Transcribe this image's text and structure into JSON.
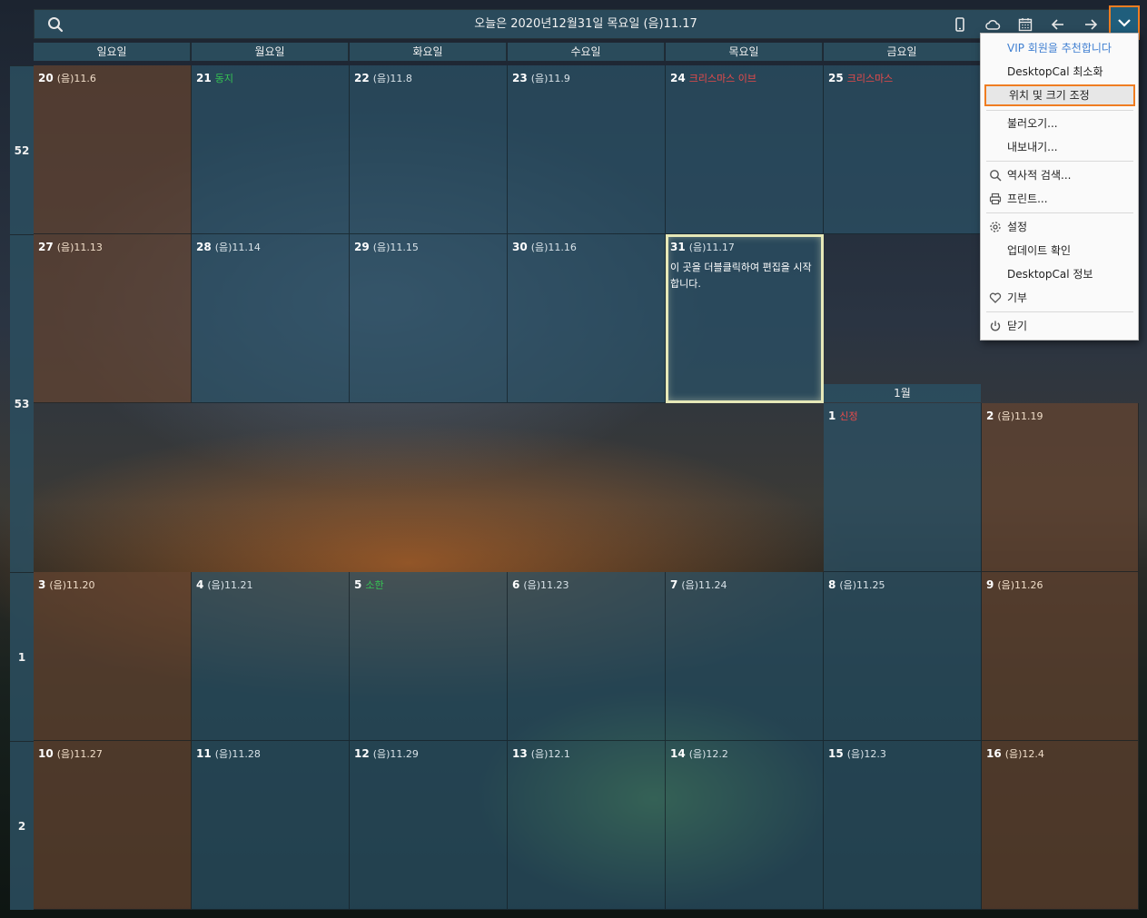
{
  "header": {
    "title": "오늘은 2020년12월31일 목요일 (음)11.17",
    "search_icon": "search-icon",
    "toolbar_icons": [
      "mobile-icon",
      "cloud-icon",
      "calendar-icon",
      "arrow-left-icon",
      "arrow-right-icon",
      "chevron-down-icon"
    ]
  },
  "days": [
    "일요일",
    "월요일",
    "화요일",
    "수요일",
    "목요일",
    "금요일"
  ],
  "month_label": "1월",
  "weeks": [
    "52",
    "53",
    "1",
    "2"
  ],
  "cells": {
    "c20": {
      "d": "20",
      "l": "(음)11.6"
    },
    "c21": {
      "d": "21",
      "h": "동지"
    },
    "c22": {
      "d": "22",
      "l": "(음)11.8"
    },
    "c23": {
      "d": "23",
      "l": "(음)11.9"
    },
    "c24": {
      "d": "24",
      "h": "크리스마스 이브"
    },
    "c25": {
      "d": "25",
      "h": "크리스마스"
    },
    "c27": {
      "d": "27",
      "l": "(음)11.13"
    },
    "c28": {
      "d": "28",
      "l": "(음)11.14"
    },
    "c29": {
      "d": "29",
      "l": "(음)11.15"
    },
    "c30": {
      "d": "30",
      "l": "(음)11.16"
    },
    "c31": {
      "d": "31",
      "l": "(음)11.17",
      "note": "이 곳을 더블클릭하여 편집을 시작합니다."
    },
    "j1": {
      "d": "1",
      "h": "신정"
    },
    "j2": {
      "d": "2",
      "l": "(음)11.19"
    },
    "j3": {
      "d": "3",
      "l": "(음)11.20"
    },
    "j4": {
      "d": "4",
      "l": "(음)11.21"
    },
    "j5": {
      "d": "5",
      "h": "소한"
    },
    "j6": {
      "d": "6",
      "l": "(음)11.23"
    },
    "j7": {
      "d": "7",
      "l": "(음)11.24"
    },
    "j8": {
      "d": "8",
      "l": "(음)11.25"
    },
    "j9": {
      "d": "9",
      "l": "(음)11.26"
    },
    "j10": {
      "d": "10",
      "l": "(음)11.27"
    },
    "j11": {
      "d": "11",
      "l": "(음)11.28"
    },
    "j12": {
      "d": "12",
      "l": "(음)11.29"
    },
    "j13": {
      "d": "13",
      "l": "(음)12.1"
    },
    "j14": {
      "d": "14",
      "l": "(음)12.2"
    },
    "j15": {
      "d": "15",
      "l": "(음)12.3"
    },
    "j16": {
      "d": "16",
      "l": "(음)12.4"
    }
  },
  "menu": {
    "vip": "VIP 회원을 추천합니다",
    "minimize": "DesktopCal 최소화",
    "position_size": "위치 및 크기 조정",
    "import": "불러오기...",
    "export": "내보내기...",
    "history": "역사적 검색...",
    "print": "프린트...",
    "settings": "설정",
    "update": "업데이트 확인",
    "about": "DesktopCal 정보",
    "donate": "기부",
    "close": "닫기"
  },
  "colors": {
    "accent_orange": "#ef7d22",
    "header_teal": "#2b4d5e",
    "holiday_red": "#e84a4a",
    "solar_term_green": "#36c253",
    "vip_blue": "#3f7fd1"
  }
}
